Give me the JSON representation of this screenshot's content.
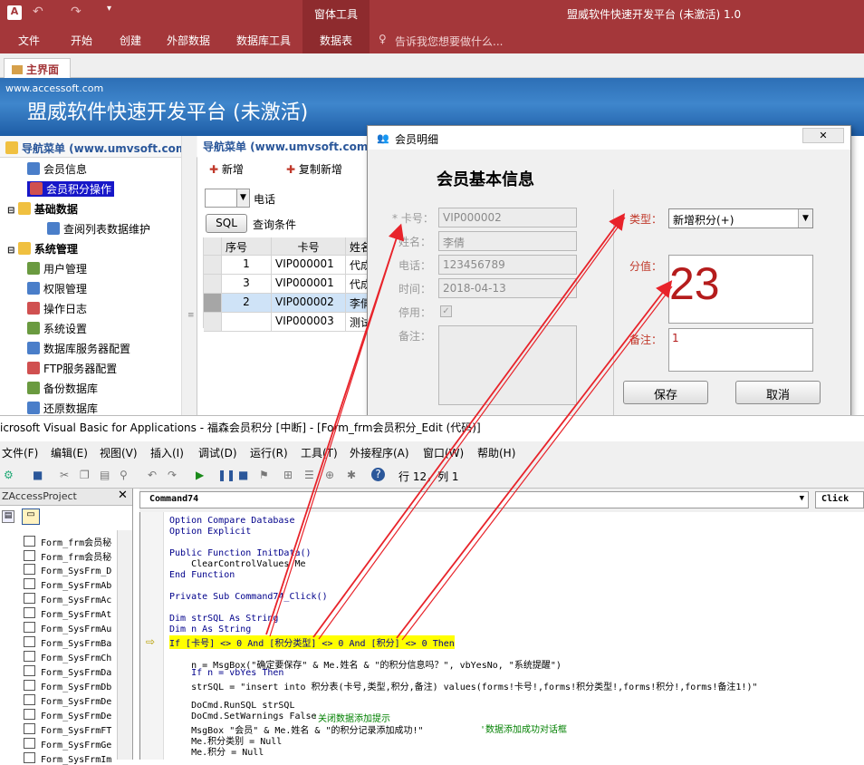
{
  "ribbon": {
    "context_title": "窗体工具",
    "app_title": "盟威软件快速开发平台 (未激活) 1.0",
    "tabs": [
      "文件",
      "开始",
      "创建",
      "外部数据",
      "数据库工具",
      "数据表"
    ],
    "tell_me": "告诉我您想要做什么..."
  },
  "doc_tab": "主界面",
  "banner": {
    "url": "www.accessoft.com",
    "title": "盟威软件快速开发平台 (未激活)"
  },
  "nav": {
    "header": "导航菜单 (www.umvsoft.com",
    "items": [
      {
        "label": "会员信息",
        "level": 1,
        "selected": false
      },
      {
        "label": "会员积分操作",
        "level": 1,
        "selected": true
      },
      {
        "label": "基础数据",
        "level": 0,
        "selected": false
      },
      {
        "label": "查阅列表数据维护",
        "level": 2,
        "selected": false
      },
      {
        "label": "系统管理",
        "level": 0,
        "selected": false
      },
      {
        "label": "用户管理",
        "level": 1,
        "selected": false
      },
      {
        "label": "权限管理",
        "level": 1,
        "selected": false
      },
      {
        "label": "操作日志",
        "level": 1,
        "selected": false
      },
      {
        "label": "系统设置",
        "level": 1,
        "selected": false
      },
      {
        "label": "数据库服务器配置",
        "level": 1,
        "selected": false
      },
      {
        "label": "FTP服务器配置",
        "level": 1,
        "selected": false
      },
      {
        "label": "备份数据库",
        "level": 1,
        "selected": false
      },
      {
        "label": "还原数据库",
        "level": 1,
        "selected": false
      }
    ]
  },
  "mid": {
    "header": "导航菜单 (www.umvsoft.com",
    "btn_new": "新增",
    "btn_copy": "复制新增",
    "filter_field": "电话",
    "sql_btn": "SQL",
    "query_label": "查询条件",
    "columns": [
      "序号",
      "卡号",
      "姓名"
    ],
    "rows": [
      [
        "1",
        "VIP000001",
        "代成"
      ],
      [
        "3",
        "VIP000001",
        "代成"
      ],
      [
        "2",
        "VIP000002",
        "李倩"
      ],
      [
        "",
        "VIP000003",
        "测试"
      ]
    ]
  },
  "dialog": {
    "title": "会员明细",
    "heading": "会员基本信息",
    "card_label": "* 卡号：",
    "card_value": "VIP000002",
    "name_label": "姓名：",
    "name_value": "李倩",
    "phone_label": "电话：",
    "phone_value": "123456789",
    "time_label": "时间：",
    "time_value": "2018-04-13",
    "disabled_label": "停用：",
    "remark_label": "备注：",
    "type_label": "类型：",
    "type_value": "新增积分(+)",
    "score_label": "分值：",
    "score_value": "23",
    "note_label": "备注：",
    "note_value": "1",
    "save": "保存",
    "cancel": "取消"
  },
  "vba": {
    "title": "icrosoft Visual Basic for Applications - 福森会员积分 [中断] - [Form_frm会员积分_Edit (代码)]",
    "menu": [
      "文件(F)",
      "编辑(E)",
      "视图(V)",
      "插入(I)",
      "调试(D)",
      "运行(R)",
      "工具(T)",
      "外接程序(A)",
      "窗口(W)",
      "帮助(H)"
    ],
    "position": "行 12，列 1",
    "project_title": "ZAccessProject",
    "object_dropdown": "Command74",
    "proc_dropdown": "Click",
    "project_items": [
      "Form_frm会员秘",
      "Form_frm会员秘",
      "Form_SysFrm_D",
      "Form_SysFrmAb",
      "Form_SysFrmAc",
      "Form_SysFrmAt",
      "Form_SysFrmAu",
      "Form_SysFrmBa",
      "Form_SysFrmCh",
      "Form_SysFrmDa",
      "Form_SysFrmDb",
      "Form_SysFrmDe",
      "Form_SysFrmDe",
      "Form_SysFrmFT",
      "Form_SysFrmGe",
      "Form_SysFrmIm"
    ],
    "code": [
      {
        "t": "Option Compare Database",
        "k": "kw"
      },
      {
        "t": "Option Explicit",
        "k": "kw"
      },
      {
        "t": "",
        "k": ""
      },
      {
        "t": "Public Function InitData()",
        "k": "kw"
      },
      {
        "t": "    ClearControlValues Me",
        "k": ""
      },
      {
        "t": "End Function",
        "k": "kw"
      },
      {
        "t": "",
        "k": ""
      },
      {
        "t": "Private Sub Command74_Click()",
        "k": "kw"
      },
      {
        "t": "",
        "k": ""
      },
      {
        "t": "Dim strSQL As String",
        "k": "kw"
      },
      {
        "t": "Dim n As String",
        "k": "kw"
      },
      {
        "t": "If [卡号] <> 0 And [积分类型] <> 0 And [积分] <> 0 Then",
        "k": "hl"
      },
      {
        "t": "",
        "k": ""
      },
      {
        "t": "    n = MsgBox(\"确定要保存\" & Me.姓名 & \"的积分信息吗？\", vbYesNo, \"系统提醒\")",
        "k": ""
      },
      {
        "t": "    If n = vbYes Then",
        "k": "kw"
      },
      {
        "t": "    strSQL = \"insert into 积分表(卡号,类型,积分,备注) values(forms!卡号!,forms!积分类型!,forms!积分!,forms!备注1!)\"",
        "k": ""
      },
      {
        "t": "",
        "k": ""
      },
      {
        "t": "    DoCmd.RunSQL strSQL",
        "k": ""
      },
      {
        "t": "    DoCmd.SetWarnings False",
        "k": ""
      },
      {
        "t": "    MsgBox \"会员\" & Me.姓名 & \"的积分记录添加成功!\"",
        "k": ""
      },
      {
        "t": "    Me.积分类别 = Null",
        "k": ""
      },
      {
        "t": "    Me.积分 = Null",
        "k": ""
      }
    ],
    "comment1": "'关闭数据添加提示",
    "comment2": "'数据添加成功对话框"
  },
  "colors": {
    "accent": "#a4373a",
    "highlight": "#ffff00",
    "arrow": "#e8232a",
    "score": "#b51c1c"
  }
}
